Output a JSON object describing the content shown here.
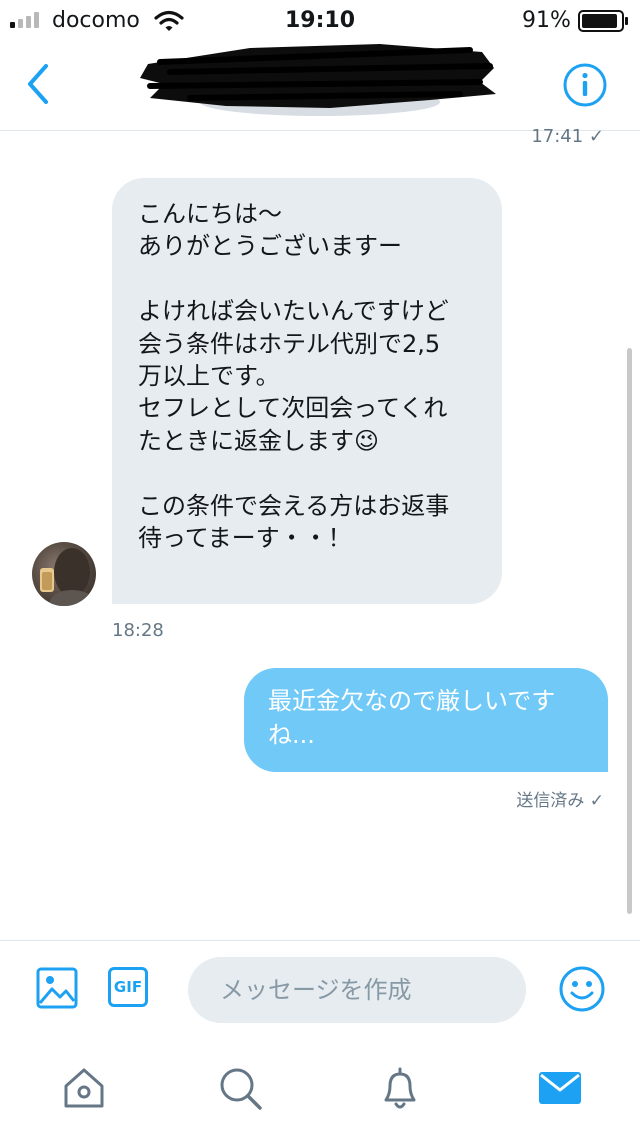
{
  "status_bar": {
    "carrier": "docomo",
    "time": "19:10",
    "battery": "91%",
    "signal_bars_active": 1,
    "battery_level": 0.91
  },
  "header": {
    "back_icon": "chevron-left-icon",
    "info_icon": "info-icon",
    "title_redacted": true
  },
  "conversation": {
    "previous_timestamp": "17:41 ✓",
    "incoming": {
      "text": "こんにちは〜\nありがとうございますー\n\nよければ会いたいんですけど\n会う条件はホテル代別で2,5\n万以上です。\nセフレとして次回会ってくれ\nたときに返金します😉\n\nこの条件で会える方はお返事\n待ってまーす・・！",
      "timestamp": "18:28"
    },
    "outgoing": {
      "text": "最近金欠なので厳しいです\nね...",
      "status": "送信済み ✓"
    }
  },
  "composer": {
    "placeholder": "メッセージを作成",
    "gif_label": "GIF",
    "image_icon": "image-icon",
    "emoji_icon": "smiley-icon"
  },
  "tab_bar": {
    "items": [
      "home-icon",
      "search-icon",
      "notifications-icon",
      "messages-icon"
    ],
    "active": "messages-icon"
  },
  "colors": {
    "accent": "#1da1f2",
    "outgoing_bubble": "#71c9f8",
    "incoming_bubble": "#e6ecf0",
    "muted_text": "#657786"
  }
}
